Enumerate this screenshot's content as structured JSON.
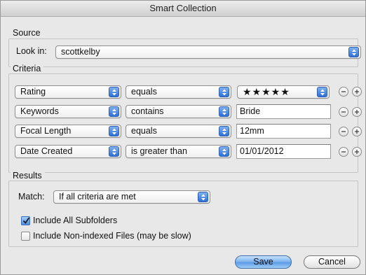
{
  "window": {
    "title": "Smart Collection"
  },
  "source": {
    "group_label": "Source",
    "look_in_label": "Look in:",
    "look_in_value": "scottkelby"
  },
  "criteria": {
    "group_label": "Criteria",
    "rows": [
      {
        "field": "Rating",
        "operator": "equals",
        "value": "★★★★★",
        "value_kind": "popup"
      },
      {
        "field": "Keywords",
        "operator": "contains",
        "value": "Bride",
        "value_kind": "text"
      },
      {
        "field": "Focal Length",
        "operator": "equals",
        "value": "12mm",
        "value_kind": "text"
      },
      {
        "field": "Date Created",
        "operator": "is greater than",
        "value": "01/01/2012",
        "value_kind": "text"
      }
    ]
  },
  "results": {
    "group_label": "Results",
    "match_label": "Match:",
    "match_value": "If all criteria are met",
    "include_subfolders": {
      "label": "Include All Subfolders",
      "checked": true
    },
    "include_nonindexed": {
      "label": "Include Non-indexed Files (may be slow)",
      "checked": false
    }
  },
  "buttons": {
    "save": "Save",
    "cancel": "Cancel"
  },
  "icons": {
    "popup_arrows": "updown-arrows-icon",
    "remove": "minus-circle-icon",
    "add": "plus-circle-icon",
    "check": "checkmark-icon"
  },
  "colors": {
    "accent": "#4a8ce0",
    "window_bg": "#e8e8e8"
  }
}
